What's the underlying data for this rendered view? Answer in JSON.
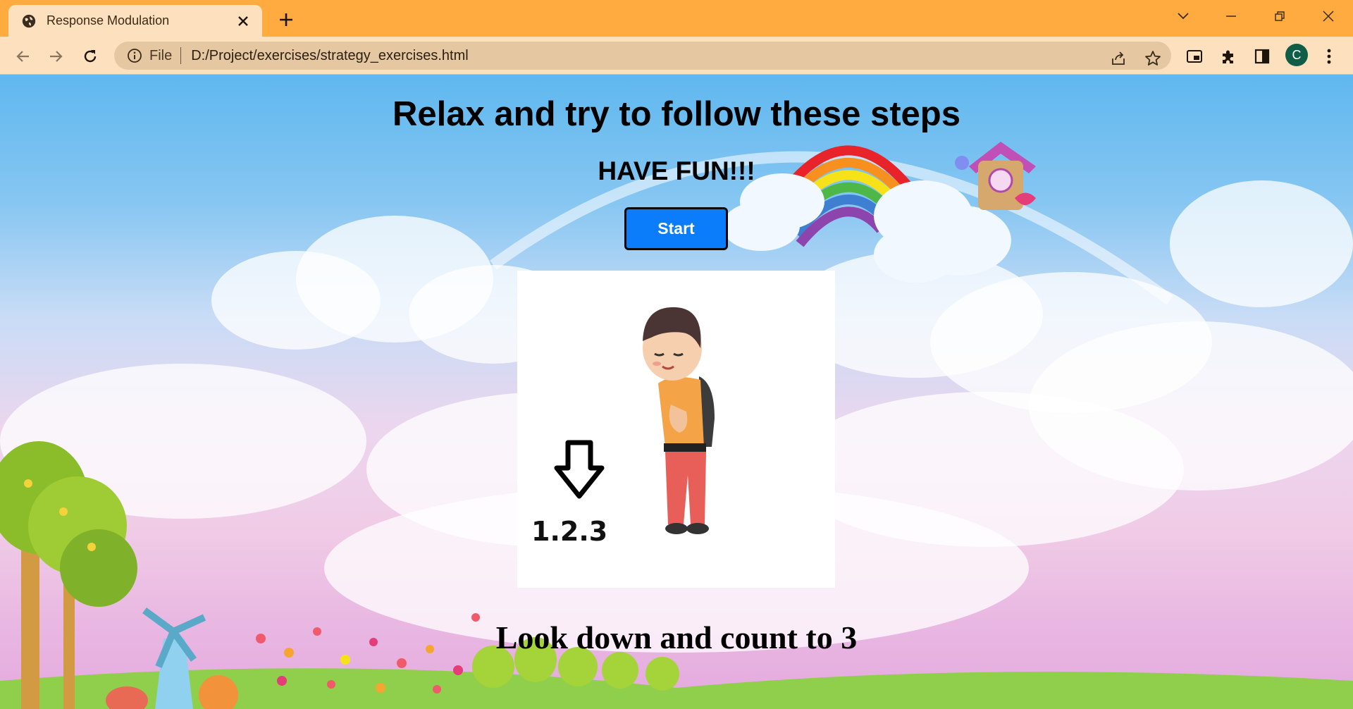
{
  "browser": {
    "tab_title": "Response Modulation",
    "url_scheme_label": "File",
    "url": "D:/Project/exercises/strategy_exercises.html",
    "profile_initial": "C",
    "icons": [
      "globe-icon",
      "close-icon",
      "plus-icon",
      "chevron-down-icon",
      "minimize-icon",
      "restore-icon",
      "window-close-icon",
      "back-arrow-icon",
      "forward-arrow-icon",
      "reload-icon",
      "info-icon",
      "share-icon",
      "star-icon",
      "picture-in-picture-icon",
      "puzzle-icon",
      "side-panel-icon",
      "kebab-menu-icon"
    ]
  },
  "page": {
    "title": "Relax and try to follow these steps",
    "subtitle": "HAVE FUN!!!",
    "start_button": "Start",
    "card": {
      "count_label": "1.2.3"
    },
    "instruction": "Look down and count to 3"
  },
  "colors": {
    "tabstrip": "#ffab40",
    "toolbar": "#fde0bd",
    "omnibox": "#e5c7a1",
    "start_button": "#0b7dfb",
    "avatar": "#0f5c47"
  }
}
